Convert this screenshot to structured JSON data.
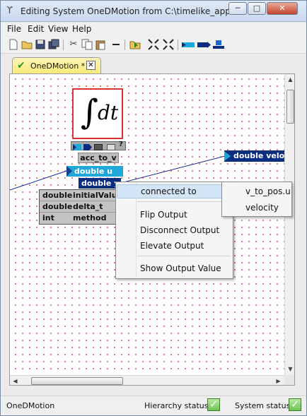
{
  "window": {
    "title": "Editing System OneDMotion from C:\\timelike_applica...",
    "buttons": {
      "minimize": "─",
      "maximize": "□",
      "close": "✕"
    }
  },
  "menu": {
    "items": [
      "File",
      "Edit",
      "View",
      "Help"
    ]
  },
  "toolbar": {
    "icons": [
      "new-file-icon",
      "open-folder-icon",
      "save-icon",
      "save-all-icon",
      "cut-icon",
      "copy-icon",
      "paste-icon",
      "delete-icon",
      "elevate-icon",
      "collapse-icon",
      "expand-icon",
      "input-port-icon",
      "output-port-icon",
      "connect-icon"
    ]
  },
  "tab": {
    "label": "OneDMotion *",
    "close": "✕"
  },
  "canvas": {
    "component": {
      "name": "acc_to_v",
      "icon_symbol": "∫",
      "icon_text": "dt",
      "help": "?",
      "input_port": "double u",
      "output_port": "double y",
      "parameters": [
        {
          "type": "double",
          "name": "initialValue"
        },
        {
          "type": "double",
          "name": "delta_t"
        },
        {
          "type": "int",
          "name": "method"
        }
      ]
    },
    "remote_port": "double velocity"
  },
  "context_menu": {
    "items": [
      "connected to",
      "Flip Output",
      "Disconnect Output",
      "Elevate Output",
      "Show Output Value"
    ],
    "submenu": [
      "v_to_pos.u",
      "velocity"
    ]
  },
  "status": {
    "system_name": "OneDMotion",
    "hierarchy_label": "Hierarchy status:",
    "system_label": "System status:",
    "ok_mark": "✓"
  }
}
